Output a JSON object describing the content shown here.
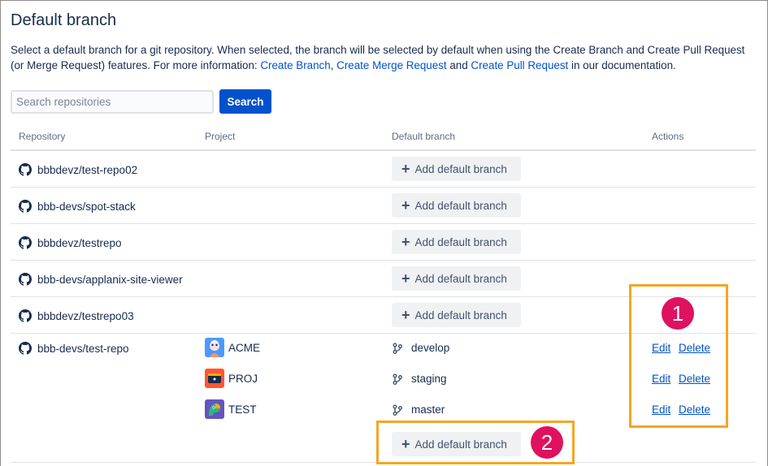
{
  "page": {
    "title": "Default branch",
    "description_prefix": "Select a default branch for a git repository. When selected, the branch will be selected by default when using the Create Branch and Create Pull Request (or Merge Request) features. For more information: ",
    "link_create_branch": "Create Branch",
    "sep1": ", ",
    "link_create_merge_request": "Create Merge Request",
    "sep2": " and ",
    "link_create_pull_request": "Create Pull Request",
    "description_suffix": " in our documentation."
  },
  "search": {
    "placeholder": "Search repositories",
    "value": "",
    "button_label": "Search"
  },
  "table": {
    "headers": {
      "repository": "Repository",
      "project": "Project",
      "default_branch": "Default branch",
      "actions": "Actions"
    },
    "add_label": "Add default branch",
    "rows": [
      {
        "repository": "bbbdevz/test-repo02"
      },
      {
        "repository": "bbb-devs/spot-stack"
      },
      {
        "repository": "bbbdevz/testrepo"
      },
      {
        "repository": "bbb-devs/applanix-site-viewer"
      },
      {
        "repository": "bbbdevz/testrepo03"
      },
      {
        "repository": "bbb-devs/test-repo",
        "entries": [
          {
            "project": "ACME",
            "branch": "develop",
            "edit": "Edit",
            "delete": "Delete"
          },
          {
            "project": "PROJ",
            "branch": "staging",
            "edit": "Edit",
            "delete": "Delete"
          },
          {
            "project": "TEST",
            "branch": "master",
            "edit": "Edit",
            "delete": "Delete"
          }
        ]
      }
    ]
  },
  "annotations": {
    "badge1": "1",
    "badge2": "2"
  },
  "colors": {
    "primary": "#0052cc",
    "highlight": "#f5a623",
    "badge": "#e0115f"
  },
  "icons": {
    "repo": "github-icon",
    "branch": "git-branch-icon",
    "add": "plus-icon"
  }
}
